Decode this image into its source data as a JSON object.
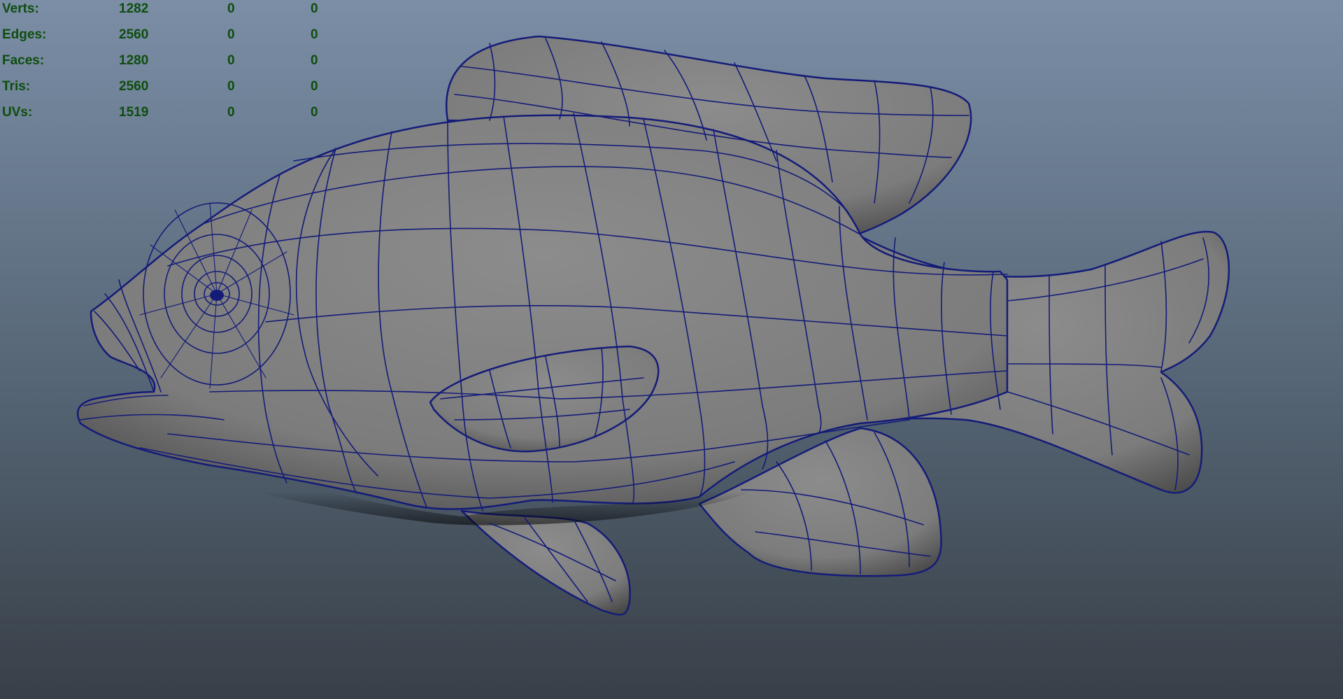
{
  "viewport": {
    "background": {
      "top": "#7b8ea6",
      "middle": "#556575",
      "bottom": "#383f47"
    }
  },
  "hud": {
    "text_color": "#0e4d0e",
    "rows": [
      {
        "label": "Verts:",
        "total": "1282",
        "selected": "0",
        "component": "0"
      },
      {
        "label": "Edges:",
        "total": "2560",
        "selected": "0",
        "component": "0"
      },
      {
        "label": "Faces:",
        "total": "1280",
        "selected": "0",
        "component": "0"
      },
      {
        "label": "Tris:",
        "total": "2560",
        "selected": "0",
        "component": "0"
      },
      {
        "label": "UVs:",
        "total": "1519",
        "selected": "0",
        "component": "0"
      }
    ]
  },
  "model": {
    "subject": "fish-mesh",
    "shade_color": "#828282",
    "wire_color": "#141c78"
  }
}
